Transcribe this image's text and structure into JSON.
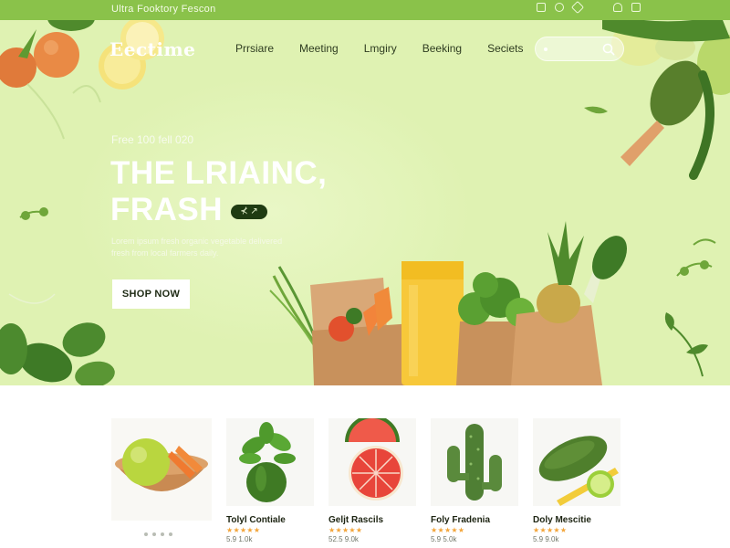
{
  "topbar": {
    "promo": "Ultra Fooktory Fescon"
  },
  "header": {
    "logo": "Eectime",
    "nav": [
      "Prrsiare",
      "Meeting",
      "Lmgiry",
      "Beeking",
      "Seciets"
    ],
    "search_placeholder": ""
  },
  "hero": {
    "eyebrow": "Free 100 fell 020",
    "headline_line1": "THE LRIAINC,",
    "headline_line2": "FRASH",
    "pill_label": "⊀ ↗",
    "description": "Lorem ipsum fresh organic vegetable delivered fresh from local farmers daily.",
    "cta": "SHOP NOW"
  },
  "products": [
    {
      "name": "",
      "stars": "",
      "price": "",
      "image": "fruit-bowl"
    },
    {
      "name": "Tolyl Contiale",
      "stars": "★★★★★",
      "price": "5.9 1.0k",
      "image": "basil-pepper"
    },
    {
      "name": "Geljt Rascils",
      "stars": "★★★★★",
      "price": "52.5 9.0k",
      "image": "grapefruit"
    },
    {
      "name": "Foly Fradenia",
      "stars": "★★★★★",
      "price": "5.9 5.0k",
      "image": "cactus"
    },
    {
      "name": "Doly Mescitie",
      "stars": "★★★★★",
      "price": "5.9 9.0k",
      "image": "bitter-gourd"
    }
  ],
  "colors": {
    "topbar": "#8ac24a",
    "hero_bg": "#dff2b2",
    "accent_dark": "#1f3b12",
    "star": "#f3a53a"
  }
}
